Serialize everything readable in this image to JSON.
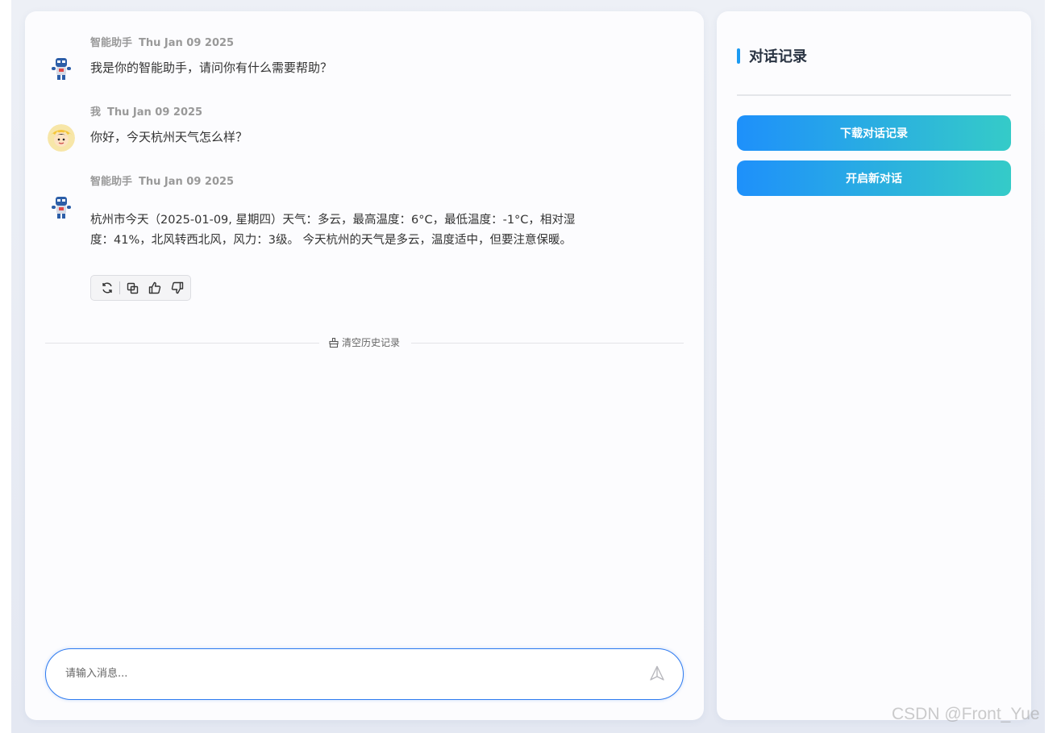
{
  "messages": [
    {
      "sender": "智能助手",
      "time": "Thu Jan 09 2025",
      "text": "我是你的智能助手，请问你有什么需要帮助？",
      "avatar": "robot-avatar"
    },
    {
      "sender": "我",
      "time": "Thu Jan 09 2025",
      "text": "你好，今天杭州天气怎么样？",
      "avatar": "user-avatar"
    },
    {
      "sender": "智能助手",
      "time": "Thu Jan 09 2025",
      "text_line1": "杭州市今天（2025-01-09, 星期四）天气：多云，最高温度：6°C，最低温度：-1°C，相对湿",
      "text_line2": "度：41%，北风转西北风，风力：3级。 今天杭州的天气是多云，温度适中，但要注意保暖。",
      "avatar": "robot-avatar"
    }
  ],
  "actions": [
    "refresh-icon",
    "copy-icon",
    "thumbs-up-icon",
    "thumbs-down-icon"
  ],
  "clear_history": "清空历史记录",
  "input": {
    "placeholder": "请输入消息...",
    "value": ""
  },
  "sidebar": {
    "title": "对话记录",
    "download_button": "下载对话记录",
    "new_chat_button": "开启新对话"
  },
  "colors": {
    "accent": "#1e90fb",
    "accent_end": "#35cbc8",
    "input_border": "#2f7bf0"
  },
  "watermark": "CSDN @Front_Yue"
}
